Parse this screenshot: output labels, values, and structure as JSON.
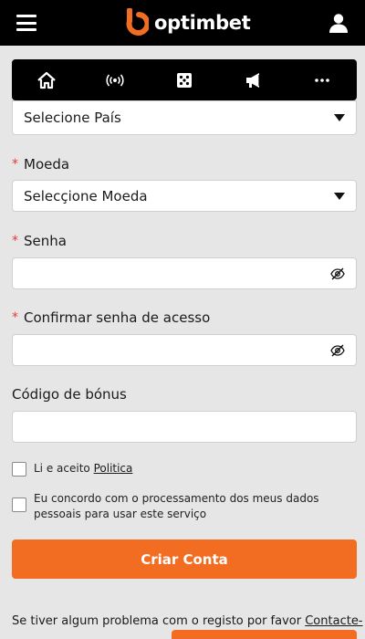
{
  "brand": {
    "name": "optimbet",
    "accent": "#f26d21"
  },
  "nav": {
    "items": [
      {
        "icon": "home-icon"
      },
      {
        "icon": "live-icon"
      },
      {
        "icon": "dice-icon"
      },
      {
        "icon": "megaphone-icon"
      },
      {
        "icon": "more-icon"
      }
    ]
  },
  "form": {
    "country": {
      "selected": "Selecione País"
    },
    "currency": {
      "label": "Moeda",
      "selected": "Selecçione Moeda"
    },
    "password": {
      "label": "Senha",
      "value": ""
    },
    "confirm": {
      "label": "Confirmar senha de acesso",
      "value": ""
    },
    "bonus": {
      "label": "Código de bónus",
      "value": ""
    },
    "terms": {
      "text": "Li e aceito",
      "link": "Politica"
    },
    "consent": {
      "text": "Eu concordo com o processamento dos meus dados pessoais para usar este serviço"
    },
    "submit_label": "Criar Conta",
    "required_mark": "*"
  },
  "help": {
    "text": "Se tiver algum problema com o registo por favor",
    "link": "Contacte-"
  }
}
